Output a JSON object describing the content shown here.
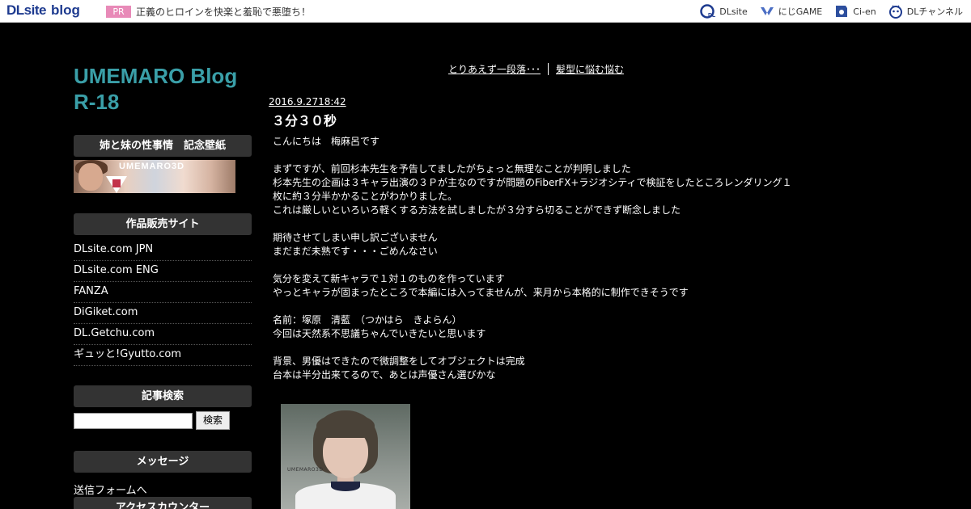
{
  "topbar": {
    "logo_main": "DLsite",
    "logo_sub": "blog",
    "pr_badge": "PR",
    "pr_text": "正義のヒロインを快楽と羞恥で悪堕ち！",
    "links": [
      {
        "label": "DLsite",
        "icon": "dlsite-icon"
      },
      {
        "label": "にじGAME",
        "icon": "nijigame-icon"
      },
      {
        "label": "Ci-en",
        "icon": "ci-en-icon"
      },
      {
        "label": "DLチャンネル",
        "icon": "dl-channel-icon"
      }
    ]
  },
  "sidebar": {
    "blog_title": "UMEMARO Blog R-18",
    "sections": {
      "wallpaper": "姉と妹の性事情　記念壁紙",
      "sales": "作品販売サイト",
      "search": "記事検索",
      "message": "メッセージ",
      "counter": "アクセスカウンター"
    },
    "banner_text": "UMEMARO3D",
    "sales_links": [
      "DLsite.com JPN",
      "DLsite.com ENG",
      "FANZA",
      "DiGiket.com",
      "DL.Getchu.com",
      "ギュッと!Gyutto.com"
    ],
    "search_placeholder": "",
    "search_button": "検索",
    "message_link": "送信フォームへ"
  },
  "main": {
    "prev_post": "とりあえず一段落･･･",
    "next_post": "髪型に悩む悩む",
    "date": "2016.9.2718:42",
    "title": "３分３０秒",
    "body": [
      "こんにちは　梅麻呂です",
      "",
      "まずですが、前回杉本先生を予告してましたがちょっと無理なことが判明しました",
      "杉本先生の企画は３キャラ出演の３Ｐが主なのですが問題のFiberFX+ラジオシティで検証をしたところレンダリング１",
      "枚に約３分半かかることがわかりました。",
      "これは厳しいといろいろ軽くする方法を試しましたが３分すら切ることができず断念しました",
      "",
      "期待させてしまい申し訳ございません",
      "まだまだ未熟です・・・ごめんなさい",
      "",
      "気分を変えて新キャラで１対１のものを作っています",
      "やっとキャラが固まったところで本編には入ってませんが、来月から本格的に制作できそうです",
      "",
      "名前：塚原　清藍　（つかはら　きよらん）",
      "今回は天然系不思議ちゃんでいきたいと思います",
      "",
      "背景、男優はできたので微調整をしてオブジェクトは完成",
      "台本は半分出来てるので、あとは声優さん選びかな"
    ],
    "image_watermark": "UMEMARO3D"
  }
}
